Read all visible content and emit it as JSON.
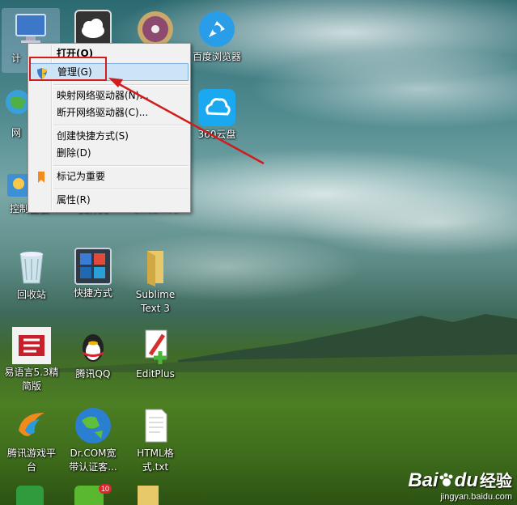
{
  "icons": [
    {
      "id": "computer",
      "label": "计"
    },
    {
      "id": "netdisk",
      "label": ""
    },
    {
      "id": "dvd",
      "label": ""
    },
    {
      "id": "baidu-browser",
      "label": "百度浏览器"
    },
    {
      "id": "network",
      "label": "网"
    },
    {
      "id": "yun360",
      "label": "360云盘"
    },
    {
      "id": "control-panel",
      "label": "控制面板"
    },
    {
      "id": "folder",
      "label": "文件夹"
    },
    {
      "id": "onedrive",
      "label": "OneDrive"
    },
    {
      "id": "recycle-bin",
      "label": "回收站"
    },
    {
      "id": "shortcuts",
      "label": "快捷方式"
    },
    {
      "id": "sublime",
      "label": "Sublime Text 3"
    },
    {
      "id": "eyuyan",
      "label": "易语言5.3精简版"
    },
    {
      "id": "qq",
      "label": "腾讯QQ"
    },
    {
      "id": "editplus",
      "label": "EditPlus"
    },
    {
      "id": "tencent-games",
      "label": "腾讯游戏平台"
    },
    {
      "id": "drcom",
      "label": "Dr.COM宽带认证客..."
    },
    {
      "id": "html-txt",
      "label": "HTML格式.txt"
    }
  ],
  "badge": "10",
  "context_menu": {
    "open": "打开(O)",
    "manage": "管理(G)",
    "map_drive": "映射网络驱动器(N)...",
    "disconnect_drive": "断开网络驱动器(C)...",
    "create_shortcut": "创建快捷方式(S)",
    "delete": "删除(D)",
    "mark_important": "标记为重要",
    "properties": "属性(R)"
  },
  "watermark": {
    "brand": "Bai",
    "brand2": "du",
    "suffix": "经验",
    "url": "jingyan.baidu.com"
  },
  "colors": {
    "annotation_red": "#d01c1c",
    "menu_highlight": "#cde4f7",
    "menu_bg": "#f1f1f1"
  }
}
